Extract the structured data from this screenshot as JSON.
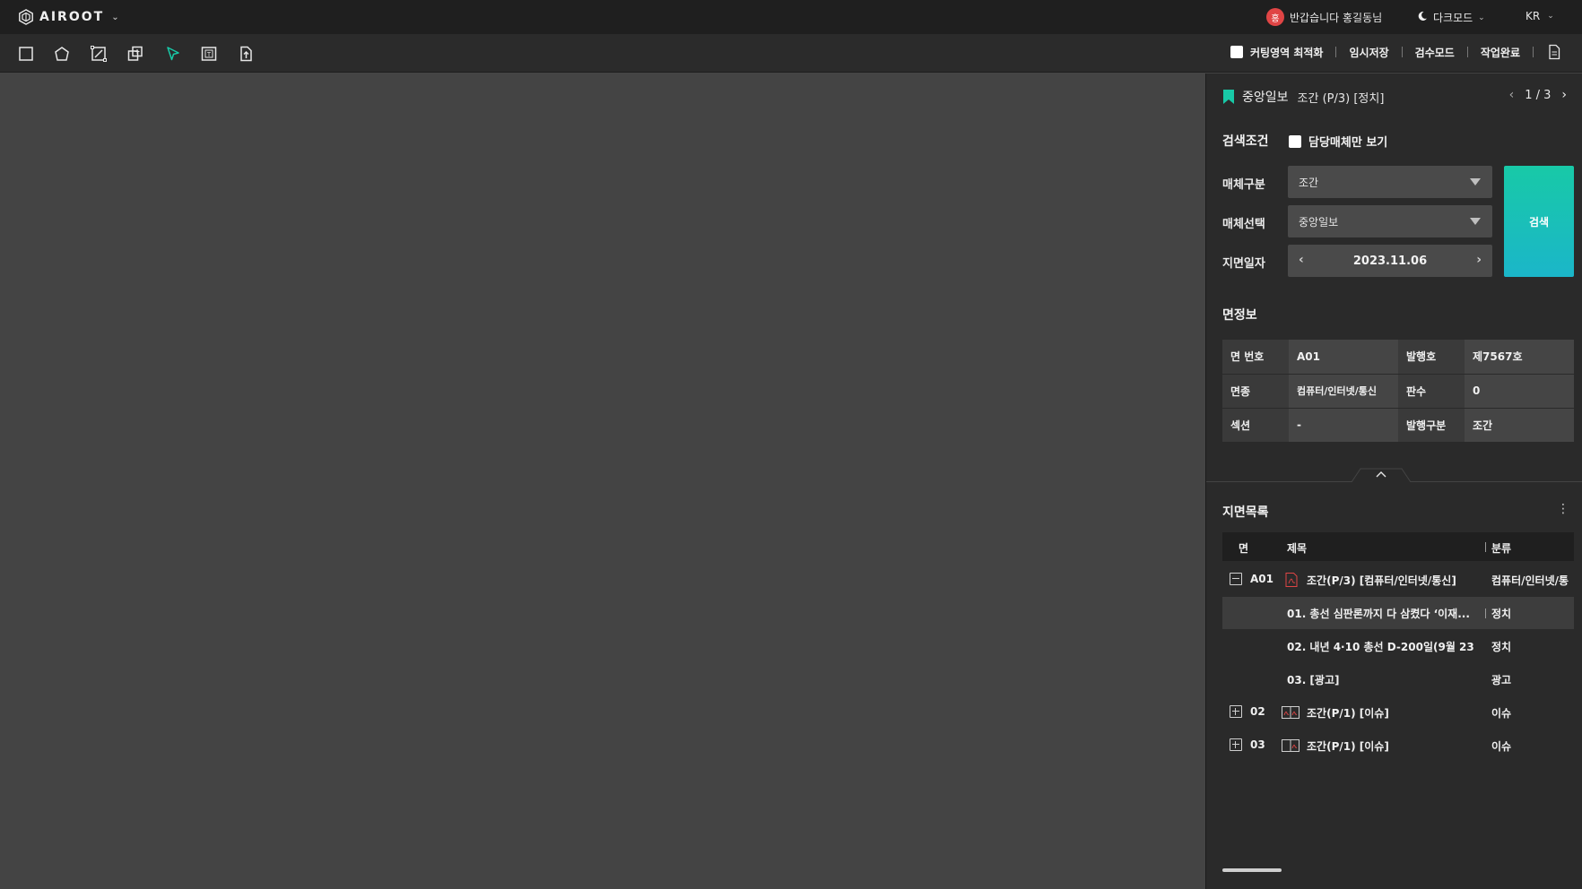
{
  "app": {
    "logo_text": "AIROOT"
  },
  "topbar": {
    "avatar_initial": "홍",
    "greeting": "반갑습니다 홍길동님",
    "darkmode_label": "다크모드",
    "language": "KR"
  },
  "toolbar": {
    "tools": [
      "rectangle-tool-icon",
      "polygon-tool-icon",
      "crop-edit-icon",
      "copy-area-icon",
      "select-cursor-icon",
      "text-box-icon",
      "export-icon"
    ],
    "cutting_label": "커팅영역 최적화",
    "temp_save_label": "임시저장",
    "review_mode_label": "검수모드",
    "complete_label": "작업완료"
  },
  "panel": {
    "paper_name": "중앙일보",
    "edition": "조간 (P/3) [정치]",
    "page_indicator": "1 / 3",
    "search": {
      "title": "검색조건",
      "only_mine_label": "담당매체만 보기",
      "media_type_label": "매체구분",
      "media_type_value": "조간",
      "media_select_label": "매체선택",
      "media_select_value": "중앙일보",
      "date_label": "지면일자",
      "date_value": "2023.11.06",
      "search_button": "검색"
    },
    "page_info": {
      "title": "면정보",
      "rows": [
        {
          "k1": "면 번호",
          "v1": "A01",
          "k2": "발행호",
          "v2": "제7567호"
        },
        {
          "k1": "면종",
          "v1": "컴퓨터/인터넷/통신",
          "k2": "판수",
          "v2": "0"
        },
        {
          "k1": "섹션",
          "v1": "-",
          "k2": "발행구분",
          "v2": "조간"
        }
      ]
    },
    "page_list": {
      "title": "지면목록",
      "columns": {
        "page": "면",
        "title": "제목",
        "category": "분류"
      },
      "rows": [
        {
          "page": "A01",
          "title": "조간(P/3) [컴퓨터/인터넷/통신]",
          "category": "컴퓨터/인터넷/통",
          "expanded": true
        },
        {
          "page": "",
          "title": "01. 총선 심판론까지 다 삼켰다 ‘이재...",
          "category": "정치"
        },
        {
          "page": "",
          "title": "02. 내년 4·10 총선 D-200일(9월 23",
          "category": "정치"
        },
        {
          "page": "",
          "title": "03. [광고]",
          "category": "광고"
        },
        {
          "page": "02",
          "title": "조간(P/1) [이슈]",
          "category": "이슈",
          "expanded": false
        },
        {
          "page": "03",
          "title": "조간(P/1) [이슈]",
          "category": "이슈",
          "expanded": false
        }
      ]
    }
  },
  "colors": {
    "accent": "#18c9a7",
    "accent_to": "#1bb6c9",
    "bookmark": "#18c9a7",
    "pdf_red": "#e04545"
  }
}
